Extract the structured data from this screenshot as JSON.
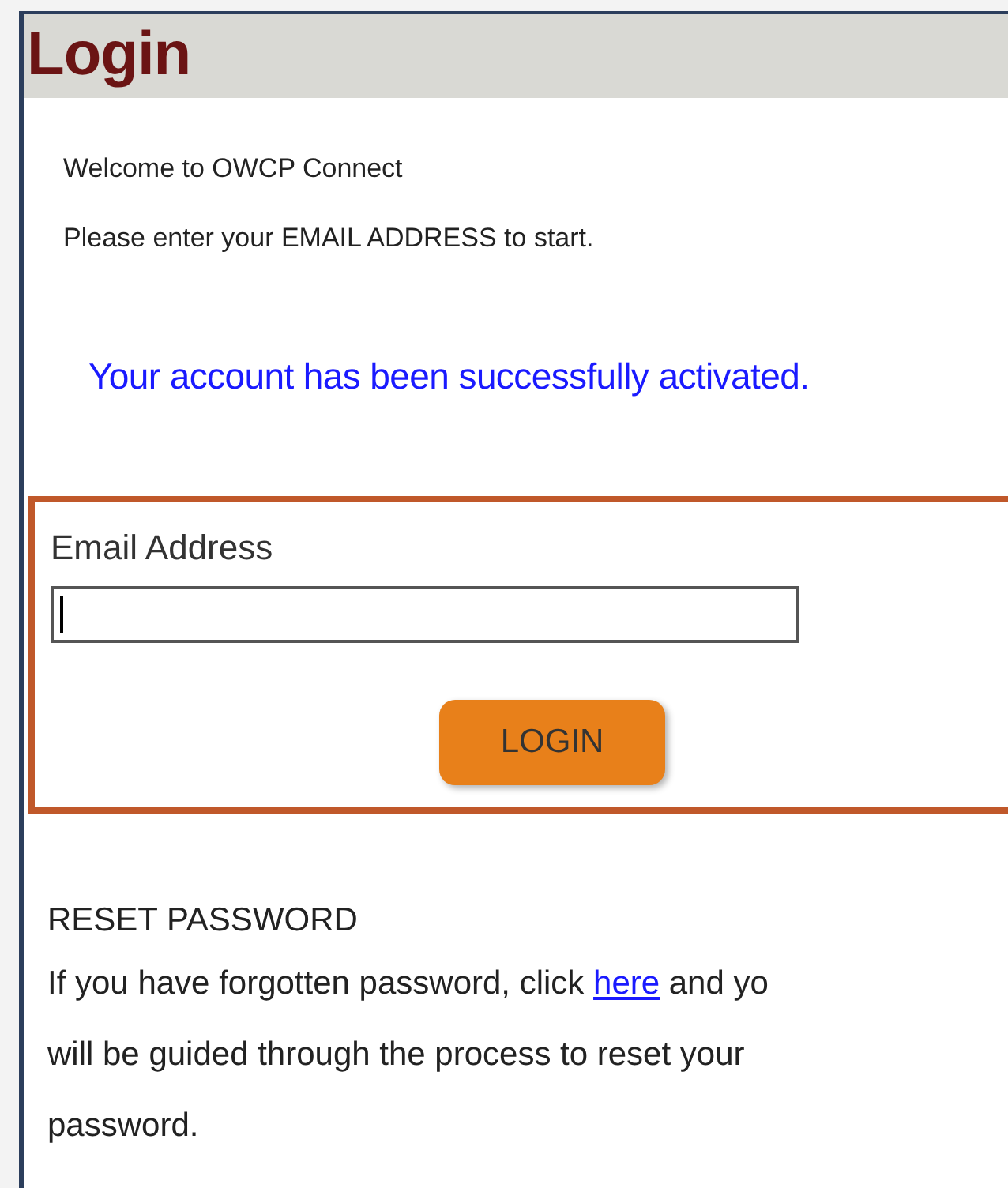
{
  "header": {
    "title": "Login"
  },
  "intro": [
    "Welcome to OWCP Connect",
    "Please enter your EMAIL ADDRESS to start."
  ],
  "status_message": "Your account has been successfully activated.",
  "login_form": {
    "label": "Email Address",
    "focused": true,
    "button": "LOGIN"
  },
  "reset": {
    "heading": "RESET PASSWORD",
    "text_before": "If you have forgotten password, click",
    "link": "here",
    "text_after": "and yo",
    "lines": [
      "will be guided through the process to reset your",
      "password."
    ]
  }
}
